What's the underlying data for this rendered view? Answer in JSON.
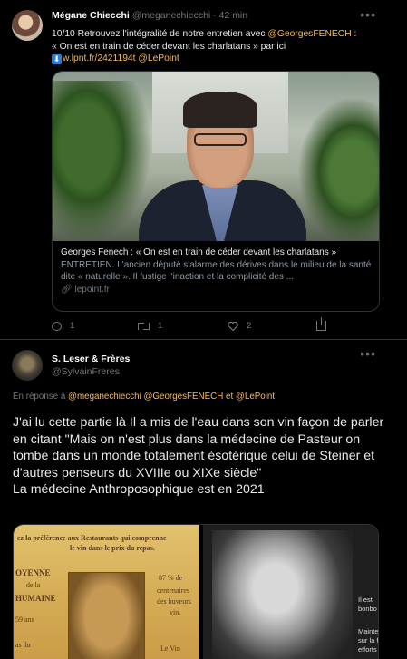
{
  "tweet1": {
    "author_name": "Mégane Chiecchi",
    "handle": "@meganechiecchi",
    "separator": "·",
    "time": "42 min",
    "more": "•••",
    "text_line1_prefix": "10/10 Retrouvez l'intégralité de notre entretien avec ",
    "mention_fenech": "@GeorgesFENECH",
    "text_line1_suffix": " :",
    "text_line2": "« On est en train de céder devant les charlatans » par ici",
    "link_url": "w.lpnt.fr/2421194t",
    "mention_lepoint": "@LePoint",
    "card": {
      "title": "Georges Fenech : « On est en train de céder devant les charlatans »",
      "description": "ENTRETIEN. L'ancien député s'alarme des dérives dans le milieu de la santé dite « naturelle ». Il fustige l'inaction et la complicité des ...",
      "source": "lepoint.fr"
    },
    "actions": {
      "replies": "1",
      "retweets": "1",
      "likes": "2"
    }
  },
  "tweet2": {
    "author_name": "S. Leser & Frères",
    "handle": "@SylvainFreres",
    "reply_prefix": "En réponse à",
    "reply_mentions": "@meganechiecchi @GeorgesFENECH",
    "reply_and": "et",
    "reply_last": "@LePoint",
    "text_paragraph": "J'ai lu cette partie là Il a mis de l'eau dans son vin façon de parler en citant \"Mais on n'est plus dans la médecine de Pasteur on tombe dans un monde totalement ésotérique celui de Steiner et d'autres penseurs du XVIIIe ou XIXe siècle\"",
    "text_line_last": "La médecine Anthroposophique est en 2021",
    "media_left": {
      "line1": "ez la préférence aux Restaurants qui comprenne",
      "line2": "le vin dans le prix du repas.",
      "left1": "OYENNE",
      "left2": "de la",
      "left3": "HUMAINE",
      "left4": "59 ans",
      "left5": "as du",
      "right1": "87 % de",
      "right2": "centenaires",
      "right3": "des buveurs",
      "right4": "vin.",
      "right5": "Le Vin"
    },
    "media_right": {
      "caption1": "Il est",
      "caption2": "bonbo",
      "caption3": "Mainte",
      "caption4": "sur la fo",
      "caption5": "efforts"
    }
  },
  "colors": {
    "background": "#000000",
    "link": "#f7b955",
    "muted": "#71767b",
    "text": "#e7e9ea"
  }
}
